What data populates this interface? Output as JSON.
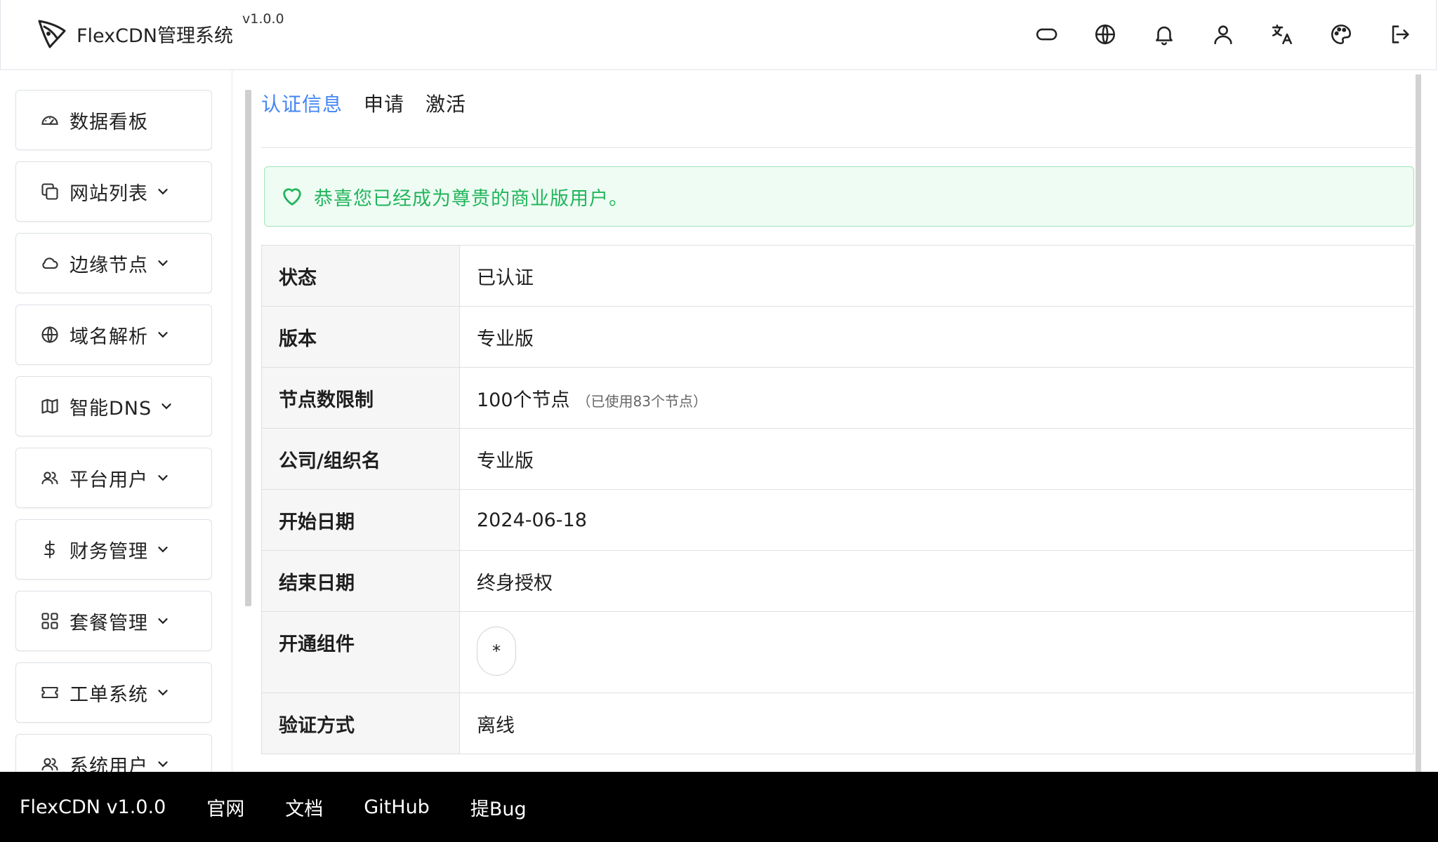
{
  "app": {
    "name": "FlexCDN管理系统",
    "version": "v1.0.0"
  },
  "topbar": {
    "icons": [
      {
        "name": "cloud-link-icon"
      },
      {
        "name": "globe-icon"
      },
      {
        "name": "bell-icon"
      },
      {
        "name": "user-icon"
      },
      {
        "name": "translate-icon"
      },
      {
        "name": "palette-icon"
      },
      {
        "name": "logout-icon"
      }
    ]
  },
  "sidebar": {
    "items": [
      {
        "label": "数据看板",
        "icon": "dashboard-icon",
        "expandable": false
      },
      {
        "label": "网站列表",
        "icon": "copy-icon",
        "expandable": true
      },
      {
        "label": "边缘节点",
        "icon": "cloud-icon",
        "expandable": true
      },
      {
        "label": "域名解析",
        "icon": "globe-icon",
        "expandable": true
      },
      {
        "label": "智能DNS",
        "icon": "map-icon",
        "expandable": true
      },
      {
        "label": "平台用户",
        "icon": "users-icon",
        "expandable": true
      },
      {
        "label": "财务管理",
        "icon": "dollar-icon",
        "expandable": true
      },
      {
        "label": "套餐管理",
        "icon": "grid-icon",
        "expandable": true
      },
      {
        "label": "工单系统",
        "icon": "ticket-icon",
        "expandable": true
      },
      {
        "label": "系统用户",
        "icon": "users-icon",
        "expandable": true
      }
    ]
  },
  "tabs": [
    {
      "label": "认证信息",
      "active": true
    },
    {
      "label": "申请",
      "active": false
    },
    {
      "label": "激活",
      "active": false
    }
  ],
  "notice": {
    "text": "恭喜您已经成为尊贵的商业版用户。"
  },
  "license": {
    "status_label": "状态",
    "status_value": "已认证",
    "edition_label": "版本",
    "edition_value": "专业版",
    "nodes_label": "节点数限制",
    "nodes_value": "100个节点",
    "nodes_used": "（已使用83个节点）",
    "org_label": "公司/组织名",
    "org_value": "专业版",
    "start_label": "开始日期",
    "start_value": "2024-06-18",
    "end_label": "结束日期",
    "end_value": "终身授权",
    "components_label": "开通组件",
    "components_value": "*",
    "verify_label": "验证方式",
    "verify_value": "离线"
  },
  "footer": {
    "brand": "FlexCDN v1.0.0",
    "links": [
      "官网",
      "文档",
      "GitHub",
      "提Bug"
    ]
  },
  "colors": {
    "accent": "#4285f4",
    "success": "#22b858",
    "notice_bg": "#effcf4",
    "notice_border": "#9fe5bb",
    "footer_bg": "#000000"
  }
}
